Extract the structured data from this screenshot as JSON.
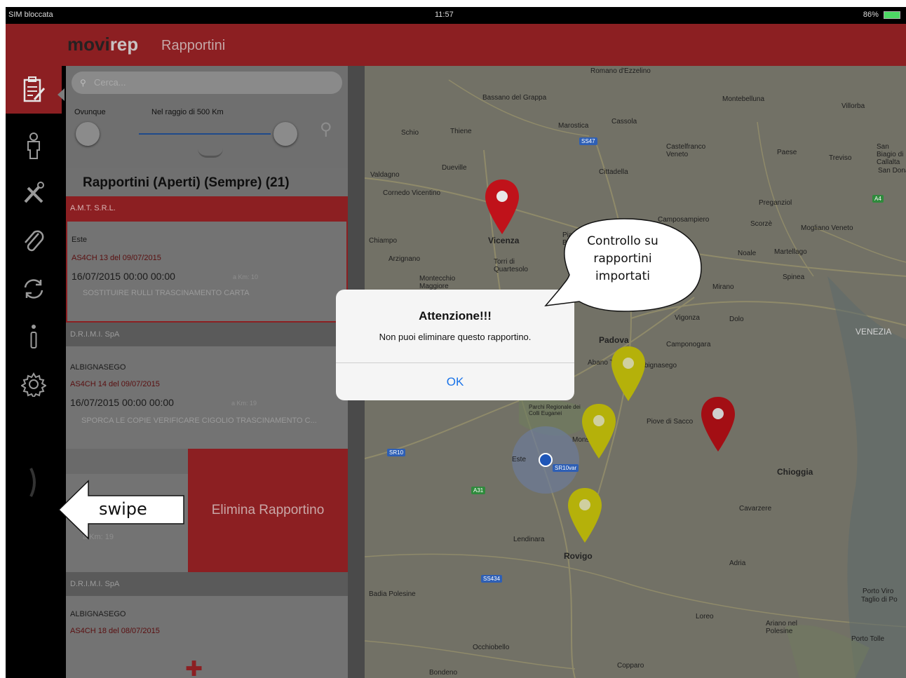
{
  "status_bar": {
    "carrier": "SIM bloccata",
    "time": "11:57",
    "battery": "86%"
  },
  "brand": {
    "part1": "movi",
    "part2": "rep",
    "title": "Rapportini"
  },
  "sidebar": {
    "items": [
      "report-icon",
      "person-icon",
      "tools-icon",
      "paperclip-icon",
      "sync-icon",
      "info-icon",
      "gear-icon",
      "chevron-right-icon"
    ]
  },
  "search": {
    "placeholder": "Cerca..."
  },
  "range": {
    "left_label": "Ovunque",
    "mid_label": "Nel raggio di 500 Km"
  },
  "list": {
    "header": "Rapportini (Aperti) (Sempre) (21)",
    "sections": [
      {
        "company": "A.M.T. S.R.L."
      },
      {
        "company": "D.R.I.M.I. SpA"
      },
      {
        "company": "D.R.I.M.I. SpA"
      }
    ],
    "cards": [
      {
        "city": "Este",
        "doc": "AS4CH 13 del 09/07/2015",
        "datetime": "16/07/2015  00:00  00:00",
        "km": "a Km: 10",
        "note": "SOSTITUIRE RULLI TRASCINAMENTO CARTA"
      },
      {
        "city": "ALBIGNASEGO",
        "doc": "AS4CH 14 del 09/07/2015",
        "datetime": "16/07/2015  00:00  00:00",
        "km": "a Km: 19",
        "note": "SPORCA LE COPIE VERIFICARE CIGOLIO TRASCINAMENTO C..."
      },
      {
        "km": "a Km: 19"
      },
      {
        "city": "ALBIGNASEGO",
        "doc": "AS4CH 18 del 08/07/2015"
      }
    ],
    "delete_label": "Elimina Rapportino"
  },
  "map": {
    "places": [
      "Romano d'Ezzelino",
      "Bassano del Grappa",
      "Montebelluna",
      "Villorba",
      "Schio",
      "Thiene",
      "Marostica",
      "Cassola",
      "Castelfranco Veneto",
      "Paese",
      "Treviso",
      "San Biagio di Callalta",
      "San Donà",
      "Valdagno",
      "Dueville",
      "Cittadella",
      "Cornedo Vicentino",
      "Preganziol",
      "Vicenza",
      "Piazzola sul Brenta",
      "Camposampiero",
      "Scorzè",
      "Mogliano Veneto",
      "Chiampo",
      "Noale",
      "Martellago",
      "Arzignano",
      "Torri di Quartesolo",
      "Mirano",
      "Spinea",
      "Montecchio Maggiore",
      "Vigonza",
      "Dolo",
      "VENEZIA",
      "Padova",
      "Camponogara",
      "Abano Terme",
      "Albignasego",
      "Piove di Sacco",
      "Monselice",
      "Este",
      "Chioggia",
      "Cavarzere",
      "Lendinara",
      "Rovigo",
      "Adria",
      "Loreo",
      "Porto Viro",
      "Taglio di Po",
      "Ariano nel Polesine",
      "Porto Tolle",
      "Occhiobello",
      "Badia Polesine",
      "Bondeno",
      "Copparo",
      "Parchi Regionale dei Colli Euganei"
    ],
    "roads": [
      "SS47",
      "A4",
      "SR10",
      "A31",
      "SR10var",
      "SS434"
    ]
  },
  "alert": {
    "title": "Attenzione!!!",
    "message": "Non puoi eliminare questo rapportino.",
    "ok": "OK"
  },
  "annotations": {
    "bubble": "Controllo su rapportini importati",
    "swipe": "swipe"
  },
  "colors": {
    "brand_red": "#8c1f22",
    "marker_red": "#c0121a",
    "marker_yellow": "#b5b10a",
    "ok_blue": "#1a73e8"
  }
}
